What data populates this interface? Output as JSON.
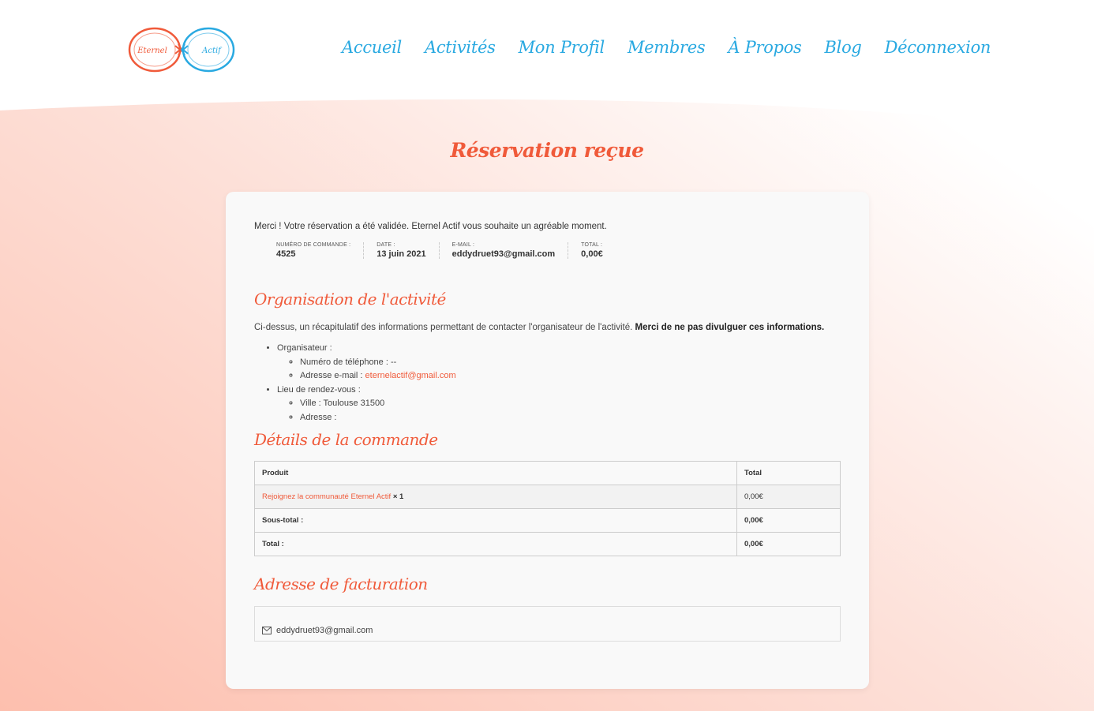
{
  "nav": {
    "items": [
      "Accueil",
      "Activités",
      "Mon Profil",
      "Membres",
      "À Propos",
      "Blog",
      "Déconnexion"
    ]
  },
  "logo": {
    "left_text": "Eternel",
    "right_text": "Actif"
  },
  "page": {
    "title": "Réservation reçue"
  },
  "order": {
    "thanks": "Merci ! Votre réservation a été validée. Eternel Actif vous souhaite un agréable moment.",
    "meta": [
      {
        "label": "Numéro de commande :",
        "value": "4525"
      },
      {
        "label": "Date :",
        "value": "13 juin 2021"
      },
      {
        "label": "E-mail :",
        "value": "eddydruet93@gmail.com"
      },
      {
        "label": "Total :",
        "value": "0,00€"
      }
    ]
  },
  "organisation": {
    "heading": "Organisation de l'activité",
    "intro": "Ci-dessus, un récapitulatif des informations permettant de contacter l'organisateur de l'activité.",
    "intro_bold": "Merci de ne pas divulguer ces informations.",
    "organizer_label": "Organisateur :",
    "phone": "Numéro de téléphone : --",
    "email_label": "Adresse e-mail : ",
    "email": "eternelactif@gmail.com",
    "meeting_label": "Lieu de rendez-vous :",
    "city": "Ville : Toulouse 31500",
    "address": "Adresse :"
  },
  "details": {
    "heading": "Détails de la commande",
    "headers": [
      "Produit",
      "Total"
    ],
    "product_name": "Rejoignez la communauté Eternel Actif",
    "product_qty": "× 1",
    "product_total": "0,00€",
    "subtotal_label": "Sous-total :",
    "subtotal_value": "0,00€",
    "total_label": "Total :",
    "total_value": "0,00€"
  },
  "billing": {
    "heading": "Adresse de facturation",
    "email": "eddydruet93@gmail.com"
  },
  "colors": {
    "accent": "#f05a3a",
    "nav": "#29a9e1",
    "bg_peach": "#fcc5b6"
  },
  "icons": {
    "billing_email": "envelope-icon"
  }
}
